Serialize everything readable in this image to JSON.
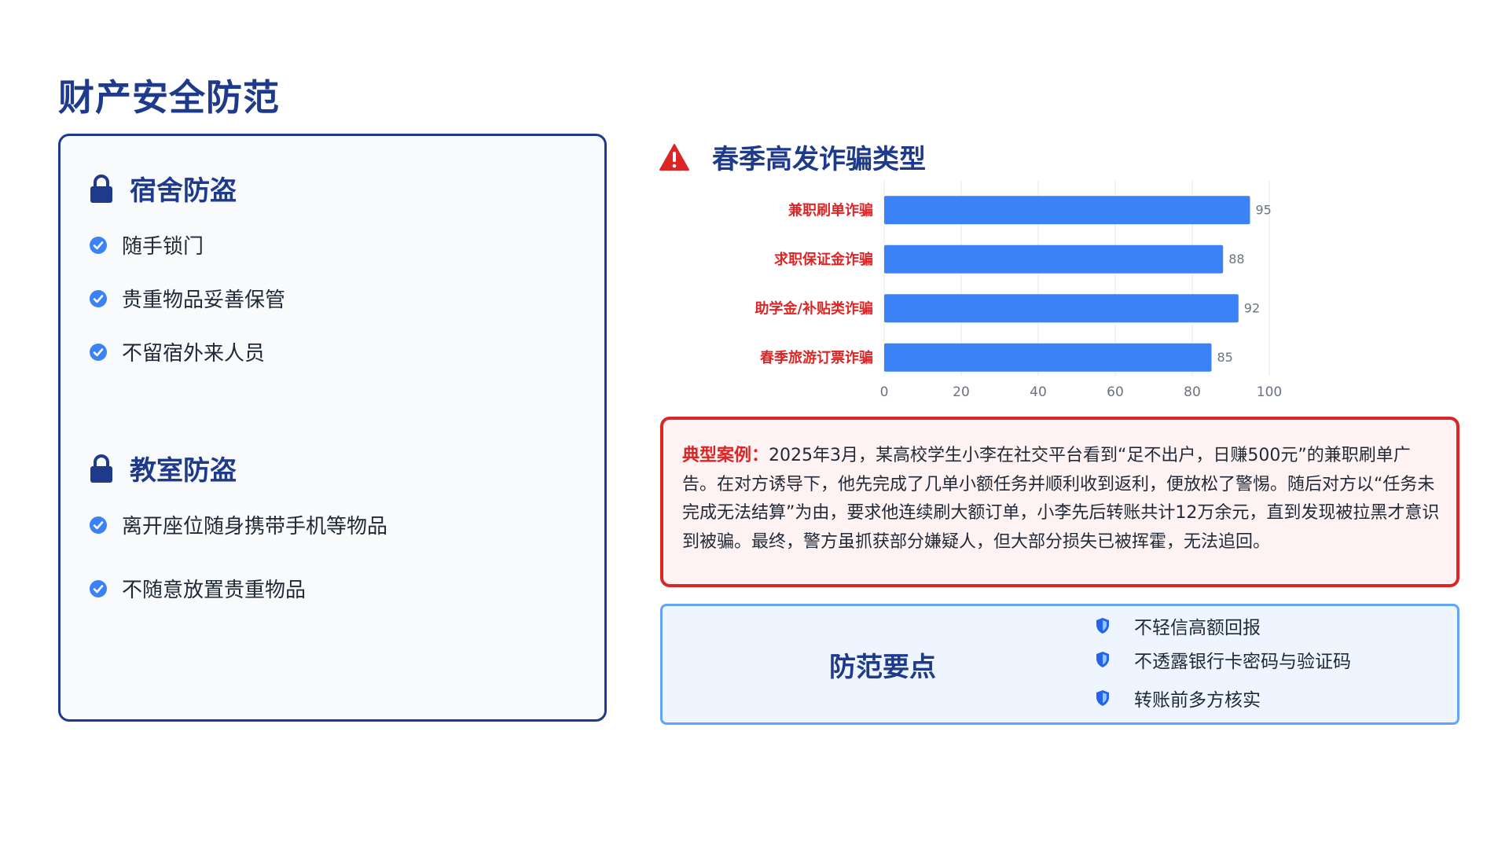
{
  "page": {
    "title": "财产安全防范"
  },
  "dorm": {
    "title": "宿舍防盗",
    "icon": "lock-icon",
    "items": [
      "随手锁门",
      "贵重物品妥善保管",
      "不留宿外来人员"
    ]
  },
  "classroom": {
    "title": "教室防盗",
    "icon": "lock-icon",
    "items": [
      "离开座位随身携带手机等物品",
      "不随意放置贵重物品"
    ]
  },
  "fraud": {
    "title": "春季高发诈骗类型",
    "icon": "warning-icon"
  },
  "chart_data": {
    "type": "bar",
    "orientation": "horizontal",
    "categories": [
      "兼职刷单诈骗",
      "求职保证金诈骗",
      "助学金/补贴类诈骗",
      "春季旅游订票诈骗"
    ],
    "values": [
      95,
      88,
      92,
      85
    ],
    "xlim": [
      0,
      100
    ],
    "xticks": [
      0,
      20,
      40,
      60,
      80,
      100
    ],
    "grid": true,
    "bar_color": "#3b82f6",
    "label_color": "#dc2626"
  },
  "case": {
    "label": "典型案例：",
    "text": "2025年3月，某高校学生小李在社交平台看到“足不出户，日赚500元”的兼职刷单广告。在对方诱导下，他先完成了几单小额任务并顺利收到返利，便放松了警惕。随后对方以“任务未完成无法结算”为由，要求他连续刷大额订单，小李先后转账共计12万余元，直到发现被拉黑才意识到被骗。最终，警方虽抓获部分嫌疑人，但大部分损失已被挥霍，无法追回。"
  },
  "tips": {
    "title": "防范要点",
    "icon": "shield-icon",
    "items": [
      "不轻信高额回报",
      "不透露银行卡密码与验证码",
      "转账前多方核实"
    ]
  },
  "colors": {
    "primary": "#1e3a8a",
    "accent": "#3b82f6",
    "danger": "#dc2626"
  }
}
